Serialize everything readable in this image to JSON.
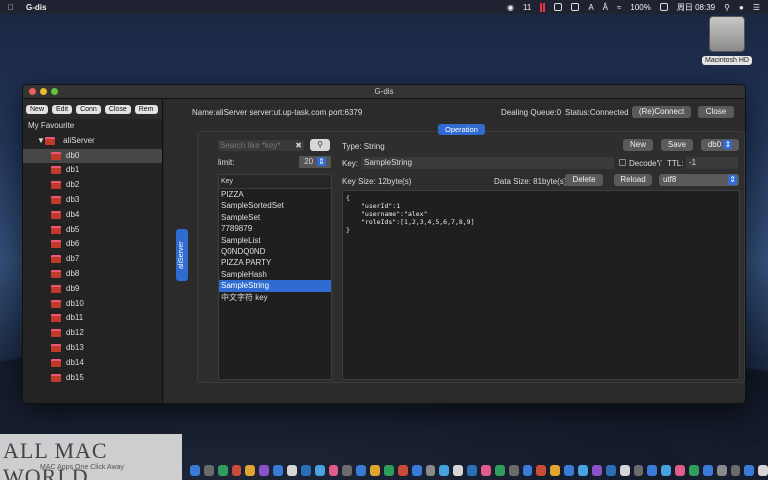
{
  "menubar": {
    "app_name": "G-dis",
    "battery": "100%",
    "time": "周日 08:39",
    "badge": "11",
    "indicator": "A"
  },
  "desktop": {
    "drive_label": "Macintosh HD"
  },
  "window": {
    "title": "G-dis"
  },
  "toolbar": {
    "buttons": [
      "New",
      "Edit",
      "Conn",
      "Close",
      "Rem"
    ]
  },
  "tree": {
    "root": "My Favourite",
    "server": "aliServer",
    "dbs": [
      "db0",
      "db1",
      "db2",
      "db3",
      "db4",
      "db5",
      "db6",
      "db7",
      "db8",
      "db9",
      "db10",
      "db11",
      "db12",
      "db13",
      "db14",
      "db15"
    ],
    "selected_db": "db0"
  },
  "header": {
    "server_info": "Name:aliServer server:ut.up-task.com port:6379",
    "queue": "Dealing Queue:0",
    "status": "Status:Connected",
    "reconnect_label": "(Re)Connect",
    "close_label": "Close"
  },
  "tabs": {
    "operation": "Operation",
    "side": "aliServer"
  },
  "search": {
    "placeholder": "Search like *key*"
  },
  "limit": {
    "label": "limit:",
    "value": "20"
  },
  "keys": {
    "header": "Key",
    "items": [
      "PIZZA",
      "SampleSortedSet",
      "SampleSet",
      "7789879",
      "SampleList",
      "Q0NDQ0ND",
      "PIZZA PARTY",
      "SampleHash",
      "SampleString",
      "中文字符 key"
    ],
    "selected": "SampleString"
  },
  "detail": {
    "type": "Type: String",
    "new_label": "New",
    "save_label": "Save",
    "db_select": "db0",
    "key_label": "Key:",
    "key_value": "SampleString",
    "decode_label": "Decode'\\'",
    "ttl_label": "TTL:",
    "ttl_value": "-1",
    "key_size": "Key Size: 12byte(s)",
    "data_size": "Data Size: 81byte(s)",
    "delete_label": "Delete",
    "reload_label": "Reload",
    "encoding": "utf8",
    "content_lines": [
      "{",
      "\"userId\":1",
      "\"username\":\"alex\"",
      "\"roleIds\":[1,2,3,4,5,6,7,8,9]",
      "}"
    ]
  },
  "watermark": {
    "title": "ALL MAC WORLD",
    "subtitle": "MAC Apps One Click Away"
  }
}
